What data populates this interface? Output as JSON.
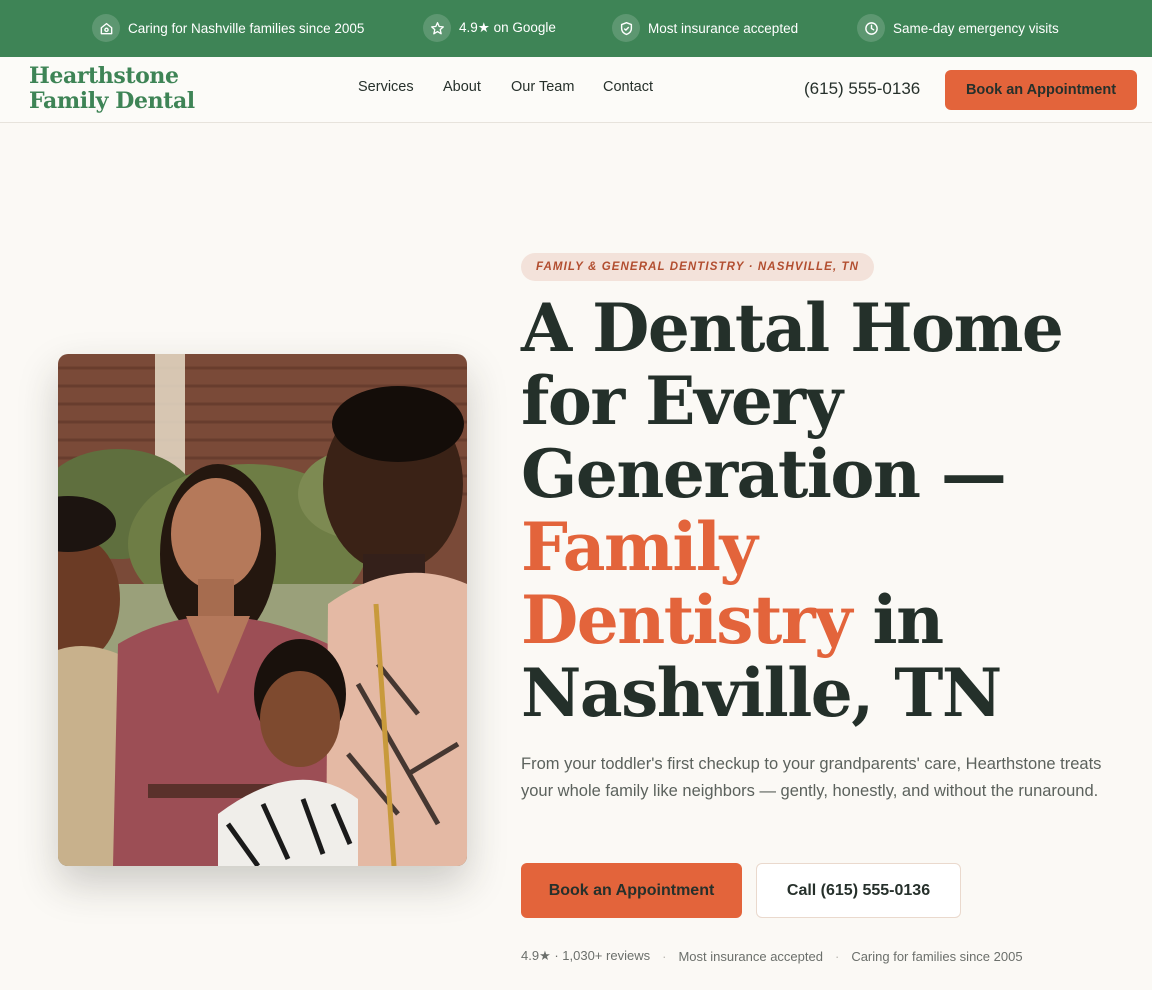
{
  "topbar": {
    "items": [
      {
        "icon": "home-heart-icon",
        "text": "Caring for Nashville families since 2005"
      },
      {
        "icon": "star-icon",
        "text": "4.9★ on Google"
      },
      {
        "icon": "shield-check-icon",
        "text": "Most insurance accepted"
      },
      {
        "icon": "clock-icon",
        "text": "Same-day emergency visits"
      }
    ]
  },
  "header": {
    "logo_line1": "Hearthstone",
    "logo_line2": "Family Dental",
    "nav": [
      "Services",
      "About",
      "Our Team",
      "Contact"
    ],
    "phone": "(615) 555-0136",
    "cta": "Book an Appointment"
  },
  "hero": {
    "eyebrow": "FAMILY & GENERAL DENTISTRY · NASHVILLE, TN",
    "headline_line1": "A Dental Home",
    "headline_line2": "for Every",
    "headline_line3": "Generation —",
    "headline_accent1": "Family",
    "headline_accent2": "Dentistry",
    "headline_after_accent": " in",
    "headline_line5": "Nashville, TN",
    "subtext": "From your toddler's first checkup to your grandparents' care, Hearthstone treats your whole family like neighbors — gently, honestly, and without the runaround.",
    "primary_button": "Book an Appointment",
    "secondary_button": "Call (615) 555-0136",
    "trust_items": [
      "4.9★ · 1,030+ reviews",
      "Most insurance accepted",
      "Caring for families since 2005"
    ],
    "trust_separator": "·"
  },
  "colors": {
    "brand_green": "#3e8456",
    "accent_orange": "#e3643b",
    "heading_dark": "#24302a",
    "background": "#fbf9f5"
  }
}
